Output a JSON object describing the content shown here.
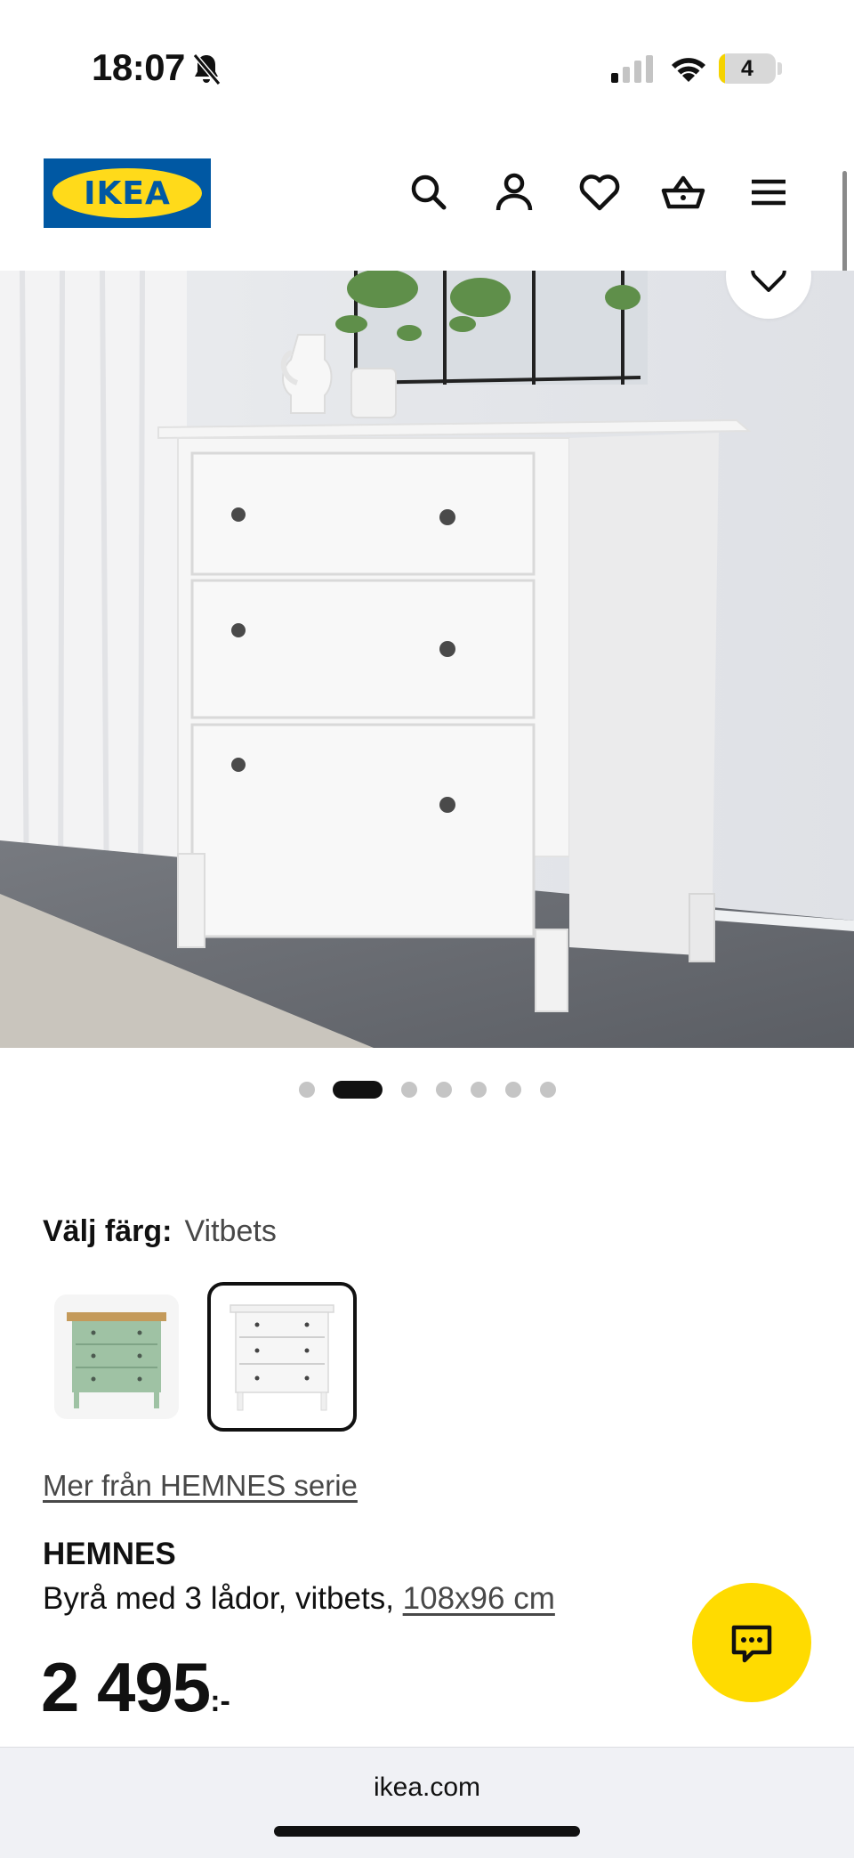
{
  "status_bar": {
    "time": "18:07",
    "battery_level": "4"
  },
  "header": {
    "logo_text": "IKEA",
    "icons": [
      "search-icon",
      "account-icon",
      "favorites-icon",
      "basket-icon",
      "menu-icon"
    ]
  },
  "gallery": {
    "image_count": 7,
    "active_index": 1
  },
  "color_selector": {
    "label": "Välj färg:",
    "selected_value": "Vitbets",
    "options": [
      "grön",
      "Vitbets"
    ]
  },
  "series_link": "Mer från HEMNES serie",
  "product": {
    "name": "HEMNES",
    "description": "Byrå med 3 lådor, vitbets, ",
    "size_link": "108x96 cm",
    "price": "2 495",
    "currency": ":-"
  },
  "browser": {
    "url": "ikea.com"
  },
  "colors": {
    "ikea_blue": "#0058a3",
    "ikea_yellow": "#ffda1a",
    "chat_yellow": "#ffdb00"
  }
}
